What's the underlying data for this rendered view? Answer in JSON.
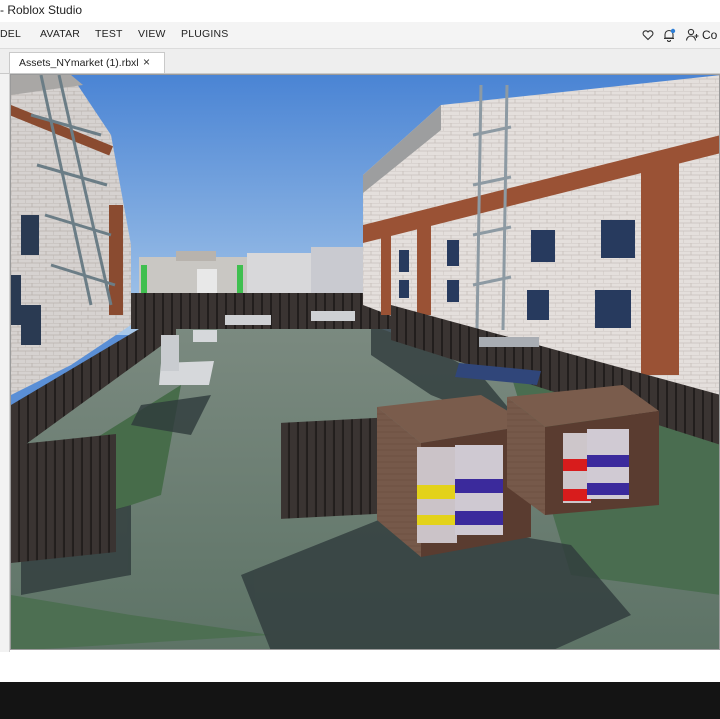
{
  "window": {
    "title": "- Roblox Studio"
  },
  "menu": {
    "items": [
      "DEL",
      "AVATAR",
      "TEST",
      "VIEW",
      "PLUGINS"
    ],
    "collab_label": "Co"
  },
  "tabs": [
    {
      "label": "Assets_NYmarket (1).rbxl",
      "close": "×"
    }
  ],
  "icons": {
    "favorite": "heart-icon",
    "notifications": "bell-icon",
    "collaborate": "add-user-icon",
    "close_tab": "close-icon"
  },
  "colors": {
    "menubar_bg": "#f4f4f4",
    "notification_dot": "#2f7fd6",
    "sky": "#5a8fd6",
    "bottom_bar": "#141414"
  }
}
